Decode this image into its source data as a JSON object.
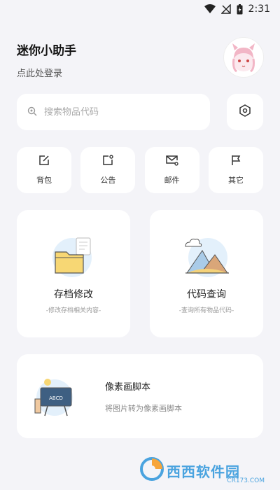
{
  "status_bar": {
    "time": "2:31"
  },
  "header": {
    "title": "迷你小助手",
    "login_text": "点此处登录"
  },
  "search": {
    "placeholder": "搜索物品代码",
    "value": ""
  },
  "quick_actions": [
    {
      "label": "背包",
      "icon": "edit-box-icon"
    },
    {
      "label": "公告",
      "icon": "notice-icon"
    },
    {
      "label": "邮件",
      "icon": "mail-icon"
    },
    {
      "label": "其它",
      "icon": "flag-icon"
    }
  ],
  "cards": [
    {
      "title": "存档修改",
      "subtitle": "-修改存档相关内容-",
      "icon": "folder-illustration"
    },
    {
      "title": "代码查询",
      "subtitle": "-查询所有物品代码-",
      "icon": "mountain-illustration"
    }
  ],
  "wide_card": {
    "title": "像素画脚本",
    "subtitle": "将图片转为像素画脚本",
    "board_text": "ABCD"
  },
  "watermark": {
    "text": "西西软件园",
    "domain": "CR173.COM"
  },
  "colors": {
    "accent": "#4aa3df",
    "background": "#f4f4f8",
    "card": "#ffffff"
  }
}
